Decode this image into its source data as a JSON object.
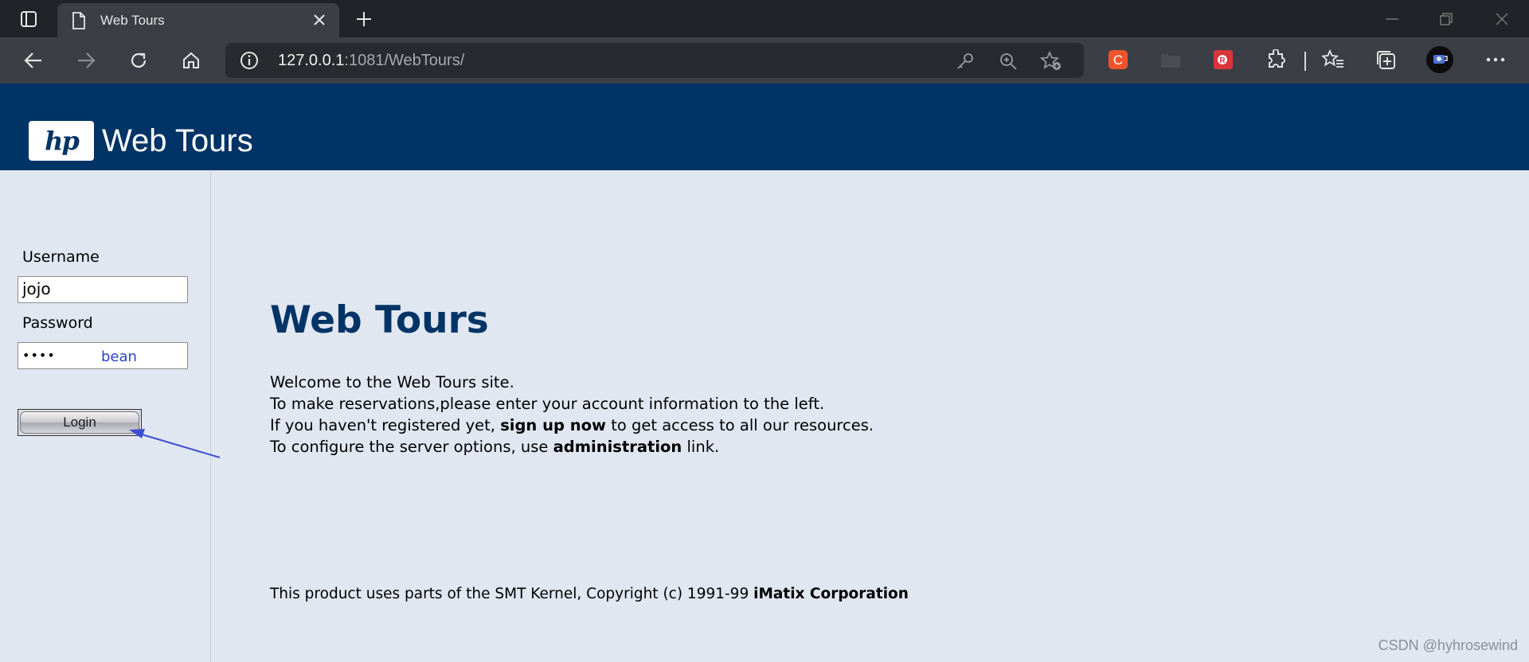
{
  "browser": {
    "tab_title": "Web Tours",
    "url_host": "127.0.0.1",
    "url_rest": ":1081/WebTours/",
    "icons": [
      "tab-actions-icon",
      "page-icon",
      "close-tab-icon",
      "new-tab-icon",
      "minimize-icon",
      "restore-icon",
      "close-window-icon",
      "back-icon",
      "forward-icon",
      "refresh-icon",
      "home-icon",
      "info-icon",
      "key-icon",
      "zoom-icon",
      "favorite-add-icon",
      "extension-c-icon",
      "extension-folder-icon",
      "extension-r-icon",
      "extensions-icon",
      "favorites-icon",
      "collections-icon",
      "profile-avatar",
      "more-icon"
    ]
  },
  "header": {
    "logo_text": "hp",
    "brand": "Web Tours"
  },
  "login": {
    "username_label": "Username",
    "username_value": "jojo",
    "password_label": "Password",
    "password_value": "••••",
    "password_note": "bean",
    "button": "Login"
  },
  "main": {
    "title": "Web Tours",
    "line1": "Welcome to the Web Tours site.",
    "line2": "To make reservations,please enter your account information to the left.",
    "line3_a": "If you haven't registered yet, ",
    "line3_b": "sign up now",
    "line3_c": " to get access to all our resources.",
    "line4_a": "To configure the server options, use ",
    "line4_b": "administration",
    "line4_c": " link."
  },
  "footer": {
    "text": "This product uses parts of the SMT Kernel, Copyright (c) 1991-99 ",
    "bold": "iMatix Corporation"
  },
  "watermark": "CSDN @hyhrosewind",
  "colors": {
    "header_bg": "#003366",
    "page_bg": "#e0e7f1",
    "title": "#003366",
    "note": "#2b43c9"
  }
}
